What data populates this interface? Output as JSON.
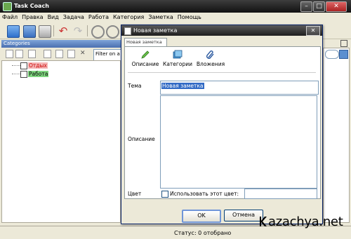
{
  "window": {
    "title": "Task Coach"
  },
  "menu": [
    "Файл",
    "Правка",
    "Вид",
    "Задача",
    "Работа",
    "Категория",
    "Заметка",
    "Помощь"
  ],
  "left_panel": {
    "title": "Categories",
    "filter_placeholder": "Filter on a",
    "categories": [
      {
        "label": "Отдых",
        "color": "#f4b6b6"
      },
      {
        "label": "Работа",
        "color": "#7fd67f"
      }
    ]
  },
  "status": {
    "text": "Статус: 0 отобрано"
  },
  "dialog": {
    "title": "Новая заметка",
    "tab": "Новая заметка",
    "sections": [
      {
        "label": "Описание",
        "icon": "pencil-icon"
      },
      {
        "label": "Категории",
        "icon": "categories-icon"
      },
      {
        "label": "Вложения",
        "icon": "paperclip-icon"
      }
    ],
    "subject_label": "Тема",
    "subject_value": "Новая заметка",
    "description_label": "Описание",
    "color_label": "Цвет",
    "use_color_label": "Использовать этот цвет:",
    "ok_label": "OK",
    "cancel_label": "Отмена"
  },
  "watermark": {
    "text": "azachya.net"
  }
}
